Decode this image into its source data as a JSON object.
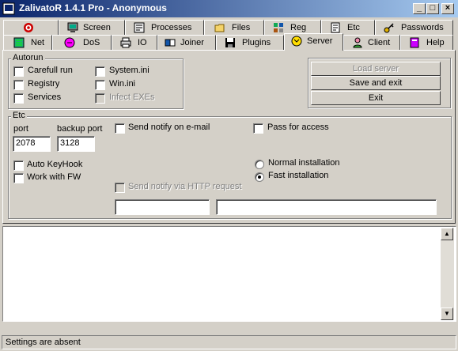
{
  "window": {
    "title": "ZalivatoR 1.4.1 Pro - Anonymous"
  },
  "tabs_row1": [
    {
      "label": "",
      "icon": "target-icon"
    },
    {
      "label": "Screen",
      "icon": "monitor-icon"
    },
    {
      "label": "Processes",
      "icon": "processes-icon"
    },
    {
      "label": "Files",
      "icon": "folder-icon"
    },
    {
      "label": "Reg",
      "icon": "registry-icon"
    },
    {
      "label": "Etc",
      "icon": "notes-icon"
    },
    {
      "label": "Passwords",
      "icon": "key-icon"
    }
  ],
  "tabs_row2": [
    {
      "label": "Net",
      "icon": "network-icon"
    },
    {
      "label": "DoS",
      "icon": "dos-icon"
    },
    {
      "label": "IO",
      "icon": "printer-icon"
    },
    {
      "label": "Joiner",
      "icon": "joiner-icon"
    },
    {
      "label": "Plugins",
      "icon": "disk-icon"
    },
    {
      "label": "Server",
      "icon": "server-icon",
      "active": true
    },
    {
      "label": "Client",
      "icon": "client-icon"
    },
    {
      "label": "Help",
      "icon": "book-icon"
    }
  ],
  "autorun": {
    "title": "Autorun",
    "items": [
      {
        "label": "Carefull run",
        "checked": false,
        "disabled": false
      },
      {
        "label": "Registry",
        "checked": false,
        "disabled": false
      },
      {
        "label": "Services",
        "checked": false,
        "disabled": false
      },
      {
        "label": "System.ini",
        "checked": false,
        "disabled": false
      },
      {
        "label": "Win.ini",
        "checked": false,
        "disabled": false
      },
      {
        "label": "Infect EXEs",
        "checked": false,
        "disabled": true
      }
    ]
  },
  "actions": {
    "load_server": "Load server",
    "save_and_exit": "Save and exit",
    "exit": "Exit"
  },
  "etc": {
    "title": "Etc",
    "port_label": "port",
    "port_value": "2078",
    "backup_port_label": "backup port",
    "backup_port_value": "3128",
    "send_notify_email": "Send notify on e-mail",
    "pass_for_access": "Pass for access",
    "auto_keyhook": "Auto KeyHook",
    "work_with_fw": "Work with FW",
    "send_notify_http": "Send notify via HTTP request",
    "normal_installation": "Normal installation",
    "fast_installation": "Fast installation",
    "selected_installation": "fast",
    "http_field_1": "",
    "http_field_2": ""
  },
  "log": {
    "content": ""
  },
  "status": {
    "text": "Settings are absent"
  }
}
